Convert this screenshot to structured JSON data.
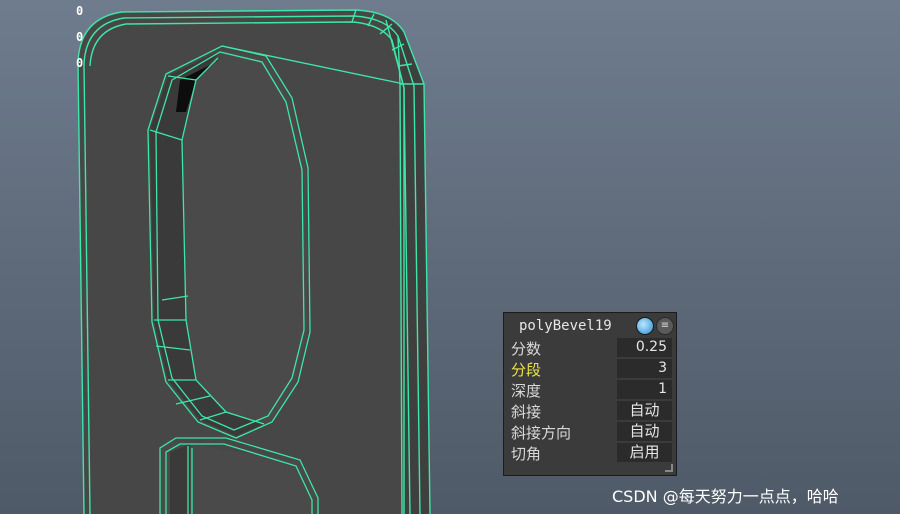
{
  "viewport": {
    "hud_values": [
      "0",
      "0",
      "0"
    ]
  },
  "panel": {
    "node_name": "polyBevel19",
    "icons": [
      "globe-icon",
      "menu-icon"
    ],
    "attributes": [
      {
        "label": "分数",
        "value": "0.25",
        "highlighted": false
      },
      {
        "label": "分段",
        "value": "3",
        "highlighted": true
      },
      {
        "label": "深度",
        "value": "1",
        "highlighted": false
      },
      {
        "label": "斜接",
        "value": "自动",
        "highlighted": false
      },
      {
        "label": "斜接方向",
        "value": "自动",
        "highlighted": false
      },
      {
        "label": "切角",
        "value": "启用",
        "highlighted": false
      }
    ]
  },
  "watermark": "CSDN @每天努力一点点，哈哈",
  "colors": {
    "wireframe": "#3ee6a8",
    "mesh_face": "#474747",
    "background": "#66728a",
    "highlight_label": "#e8e24a"
  }
}
